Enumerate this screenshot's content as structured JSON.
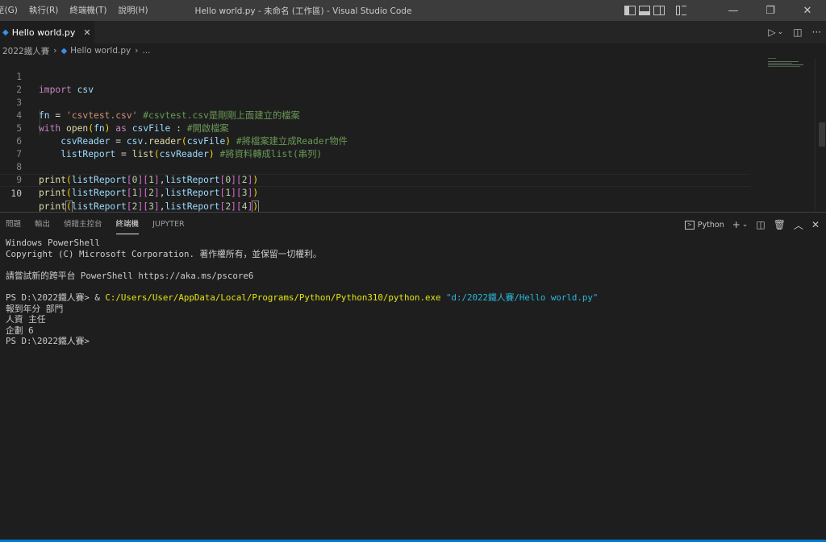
{
  "menu": [
    "至(G)",
    "執行(R)",
    "終端機(T)",
    "說明(H)"
  ],
  "window_title": "Hello world.py - 未命名 (工作區) - Visual Studio Code",
  "window_controls": {
    "minimize": "—",
    "restore": "❐",
    "close": "✕"
  },
  "tab": {
    "file_icon": "python-file-icon",
    "label": "Hello world.py",
    "close": "✕"
  },
  "breadcrumb": {
    "folder": "2022鐵人賽",
    "file": "Hello world.py",
    "more": "..."
  },
  "editor": {
    "line_numbers": [
      "1",
      "2",
      "3",
      "4",
      "5",
      "6",
      "7",
      "8",
      "9",
      "10"
    ],
    "current_line": 10
  },
  "panel": {
    "tabs": [
      "問題",
      "輸出",
      "偵錯主控台",
      "終端機",
      "JUPYTER"
    ],
    "active_tab": "終端機",
    "terminal_profile": "Python",
    "terminal_lines": {
      "l1": "Windows PowerShell",
      "l2": "Copyright (C) Microsoft Corporation. 著作權所有，並保留一切權利。",
      "l3": "",
      "l4": "請嘗試新的跨平台 PowerShell https://aka.ms/pscore6",
      "l5": "",
      "prompt1": "PS D:\\2022鐵人賽> ",
      "amp": "& ",
      "exe": "C:/Users/User/AppData/Local/Programs/Python/Python310/python.exe",
      "arg": " \"d:/2022鐵人賽/Hello world.py\"",
      "l7": "報到年分 部門",
      "l8": "人資 主任",
      "l9": "企劃 6",
      "l10": "PS D:\\2022鐵人賽>"
    }
  },
  "colors": {
    "accent": "#007acc",
    "background": "#1e1e1e",
    "titlebar": "#3c3c3c"
  }
}
